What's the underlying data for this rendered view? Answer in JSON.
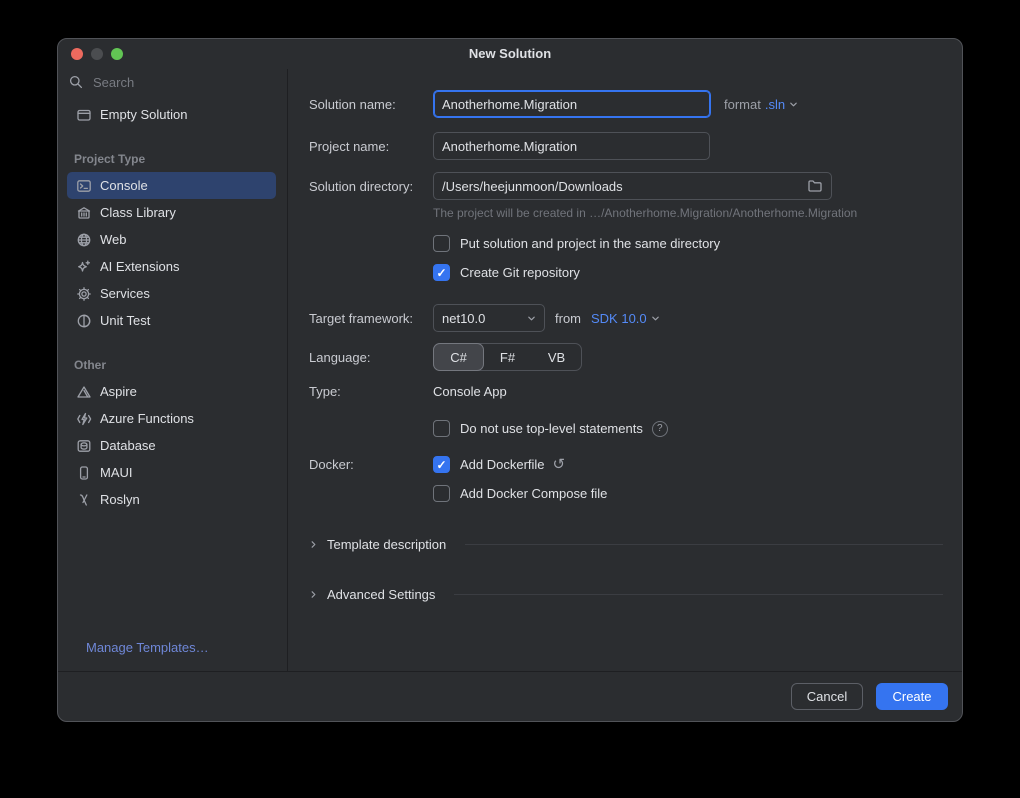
{
  "window": {
    "title": "New Solution",
    "traffic_lights": [
      "close",
      "minimize",
      "zoom"
    ]
  },
  "colors": {
    "accent": "#3574f0",
    "selection": "#2e436e",
    "link": "#548af7",
    "dialog_bg": "#2b2d30"
  },
  "sidebar": {
    "search": {
      "placeholder": "Search",
      "icon": "search-icon"
    },
    "empty_solution": {
      "label": "Empty Solution",
      "icon": "window-icon"
    },
    "sections": [
      {
        "header": "Project Type",
        "items": [
          {
            "label": "Console",
            "icon": "terminal-icon",
            "selected": true
          },
          {
            "label": "Class Library",
            "icon": "library-icon",
            "selected": false
          },
          {
            "label": "Web",
            "icon": "globe-icon",
            "selected": false
          },
          {
            "label": "AI Extensions",
            "icon": "sparkle-icon",
            "selected": false
          },
          {
            "label": "Services",
            "icon": "gear-icon",
            "selected": false
          },
          {
            "label": "Unit Test",
            "icon": "flask-icon",
            "selected": false
          }
        ]
      },
      {
        "header": "Other",
        "items": [
          {
            "label": "Aspire",
            "icon": "triangle-icon",
            "selected": false
          },
          {
            "label": "Azure Functions",
            "icon": "lightning-icon",
            "selected": false
          },
          {
            "label": "Database",
            "icon": "database-icon",
            "selected": false
          },
          {
            "label": "MAUI",
            "icon": "phone-icon",
            "selected": false
          },
          {
            "label": "Roslyn",
            "icon": "lambda-icon",
            "selected": false
          }
        ]
      }
    ],
    "manage_templates_label": "Manage Templates…"
  },
  "form": {
    "solution_name": {
      "label": "Solution name:",
      "value": "Anotherhome.Migration"
    },
    "format": {
      "label": "format",
      "value": ".sln"
    },
    "project_name": {
      "label": "Project name:",
      "value": "Anotherhome.Migration"
    },
    "solution_directory": {
      "label": "Solution directory:",
      "value": "/Users/heejunmoon/Downloads",
      "icon": "folder-icon"
    },
    "hint": "The project will be created in …/Anotherhome.Migration/Anotherhome.Migration",
    "checkbox_same_directory": {
      "label": "Put solution and project in the same directory",
      "checked": false
    },
    "checkbox_git": {
      "label": "Create Git repository",
      "checked": true
    },
    "target_framework": {
      "label": "Target framework:",
      "value": "net10.0",
      "from_label": "from",
      "sdk_link": "SDK 10.0"
    },
    "language": {
      "label": "Language:",
      "options": [
        "C#",
        "F#",
        "VB"
      ],
      "selected": "C#"
    },
    "type": {
      "label": "Type:",
      "value": "Console App"
    },
    "checkbox_top_level": {
      "label": "Do not use top-level statements",
      "checked": false,
      "help_icon": "help-icon"
    },
    "docker": {
      "label": "Docker:",
      "add_dockerfile": {
        "label": "Add Dockerfile",
        "checked": true,
        "reset_icon": "undo-icon"
      },
      "add_compose": {
        "label": "Add Docker Compose file",
        "checked": false
      }
    },
    "template_description": {
      "label": "Template description",
      "collapsed": true
    },
    "advanced_settings": {
      "label": "Advanced Settings",
      "collapsed": true
    }
  },
  "footer": {
    "cancel_label": "Cancel",
    "create_label": "Create"
  }
}
